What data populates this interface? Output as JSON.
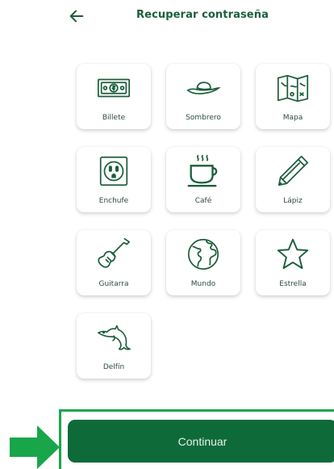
{
  "header": {
    "title": "Recuperar contraseña"
  },
  "icons": {
    "back": "arrow-left-icon"
  },
  "items": [
    {
      "label": "Billete",
      "icon": "banknote-icon"
    },
    {
      "label": "Sombrero",
      "icon": "hat-icon"
    },
    {
      "label": "Mapa",
      "icon": "map-icon"
    },
    {
      "label": "Enchufe",
      "icon": "outlet-icon"
    },
    {
      "label": "Café",
      "icon": "coffee-icon"
    },
    {
      "label": "Lápiz",
      "icon": "pencil-icon"
    },
    {
      "label": "Guitarra",
      "icon": "guitar-icon"
    },
    {
      "label": "Mundo",
      "icon": "globe-icon"
    },
    {
      "label": "Estrella",
      "icon": "star-icon"
    },
    {
      "label": "Delfín",
      "icon": "dolphin-icon"
    }
  ],
  "footer": {
    "continue_label": "Continuar"
  },
  "colors": {
    "primary": "#0f6a3a",
    "highlight": "#19a64a",
    "text": "#1b5e3b"
  }
}
